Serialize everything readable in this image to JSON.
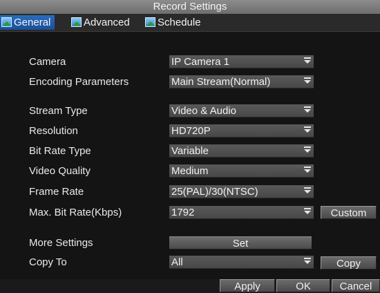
{
  "window": {
    "title": "Record Settings"
  },
  "tabs": [
    {
      "label": "General",
      "icon": "tab-icon"
    },
    {
      "label": "Advanced",
      "icon": "tab-icon"
    },
    {
      "label": "Schedule",
      "icon": "tab-icon"
    }
  ],
  "form": {
    "camera": {
      "label": "Camera",
      "value": "IP Camera 1"
    },
    "encoding_parameters": {
      "label": "Encoding Parameters",
      "value": "Main Stream(Normal)"
    },
    "stream_type": {
      "label": "Stream Type",
      "value": "Video & Audio"
    },
    "resolution": {
      "label": "Resolution",
      "value": "HD720P"
    },
    "bit_rate_type": {
      "label": "Bit Rate Type",
      "value": "Variable"
    },
    "video_quality": {
      "label": "Video Quality",
      "value": "Medium"
    },
    "frame_rate": {
      "label": "Frame Rate",
      "value": "25(PAL)/30(NTSC)"
    },
    "max_bit_rate": {
      "label": "Max. Bit Rate(Kbps)",
      "value": "1792",
      "button": "Custom"
    },
    "more_settings": {
      "label": "More Settings",
      "button": "Set"
    },
    "copy_to": {
      "label": "Copy To",
      "value": "All",
      "button": "Copy"
    }
  },
  "footer": {
    "apply": "Apply",
    "ok": "OK",
    "cancel": "Cancel"
  }
}
